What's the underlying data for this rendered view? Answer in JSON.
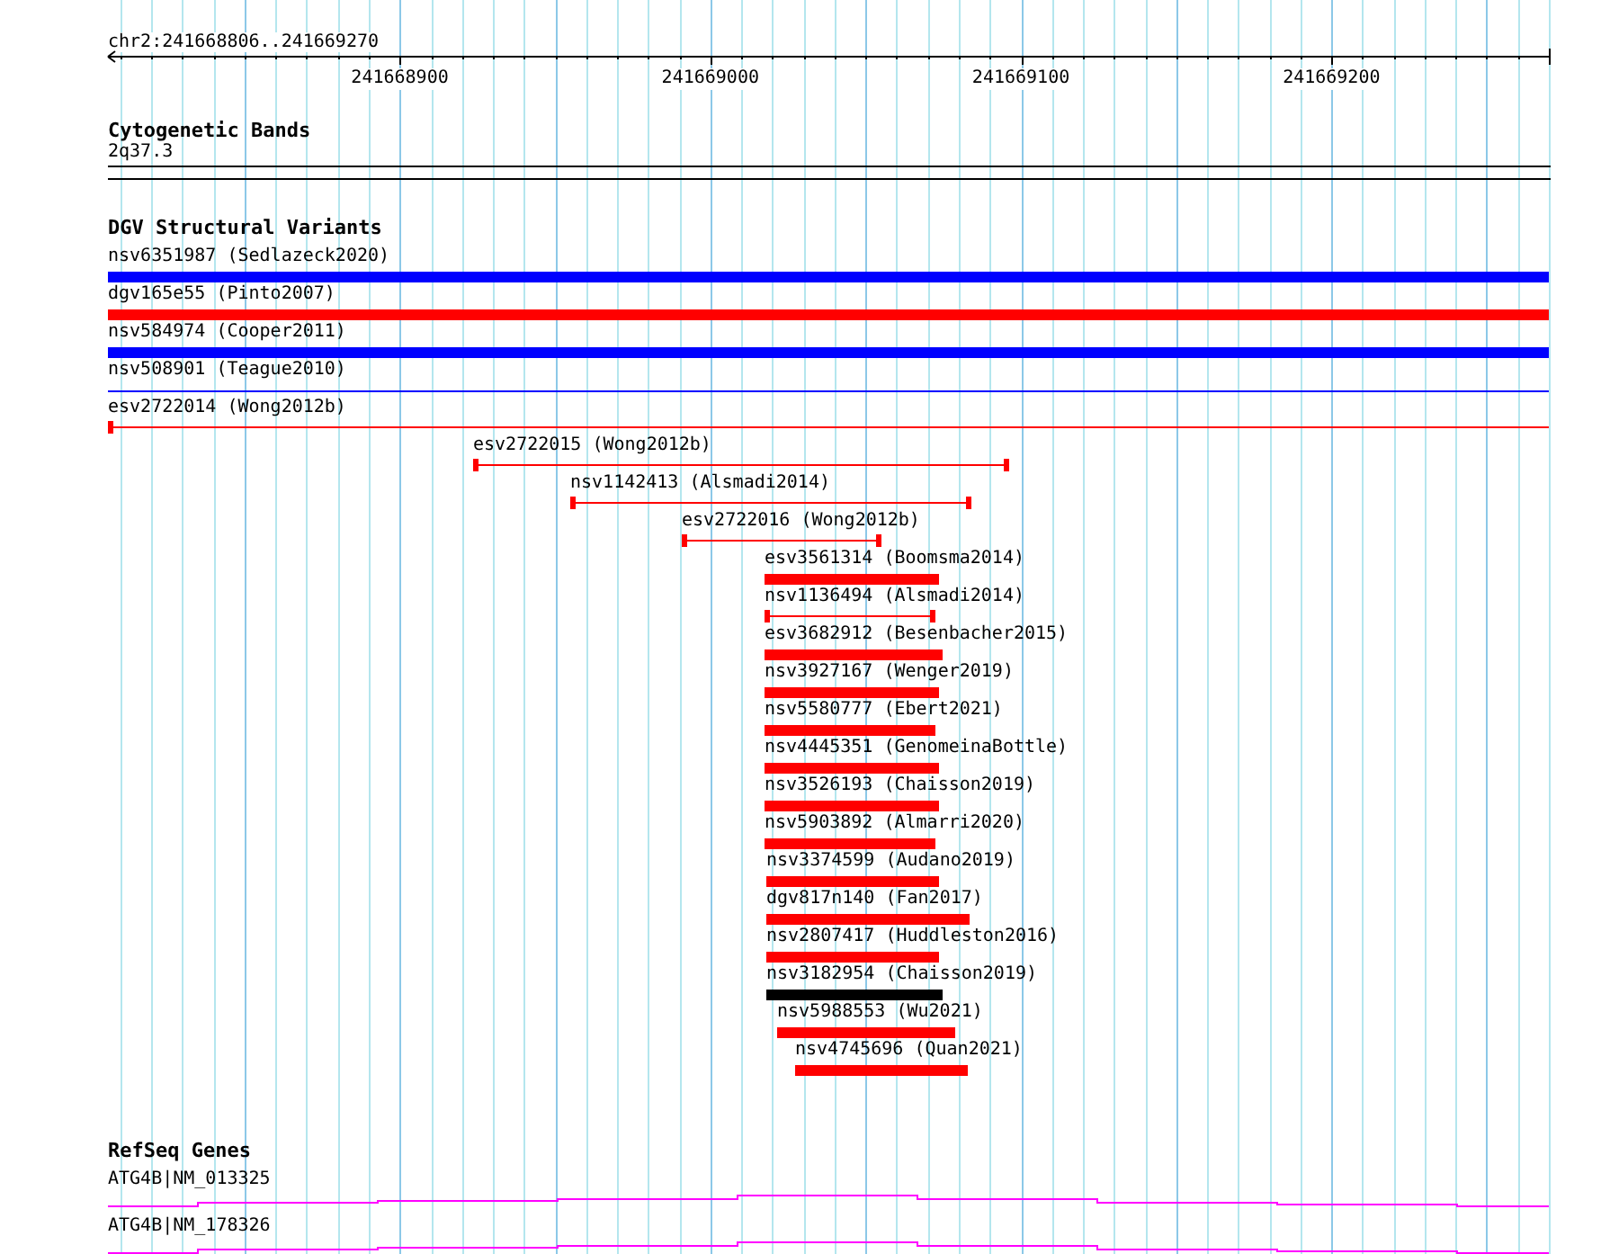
{
  "ruler": {
    "region": "chr2:241668806..241669270",
    "tick_labels": [
      "241668900",
      "241669000",
      "241669100",
      "241669200"
    ]
  },
  "cytogenetic_bands": {
    "title": "Cytogenetic Bands",
    "band": "2q37.3"
  },
  "dgv_structural_variants": {
    "title": "DGV Structural Variants",
    "features": [
      {
        "label": "nsv6351987 (Sedlazeck2020)",
        "kind": "thick",
        "color": "#0000ff"
      },
      {
        "label": "dgv165e55 (Pinto2007)",
        "kind": "thick",
        "color": "#ff0000"
      },
      {
        "label": "nsv584974 (Cooper2011)",
        "kind": "thick",
        "color": "#0000ff"
      },
      {
        "label": "nsv508901 (Teague2010)",
        "kind": "thin",
        "color": "#0000ff"
      },
      {
        "label": "esv2722014 (Wong2012b)",
        "kind": "capped",
        "color": "#ff0000"
      },
      {
        "label": "esv2722015 (Wong2012b)",
        "kind": "capped",
        "color": "#ff0000"
      },
      {
        "label": "nsv1142413 (Alsmadi2014)",
        "kind": "capped",
        "color": "#ff0000"
      },
      {
        "label": "esv2722016 (Wong2012b)",
        "kind": "capped",
        "color": "#ff0000"
      },
      {
        "label": "esv3561314 (Boomsma2014)",
        "kind": "thick",
        "color": "#ff0000"
      },
      {
        "label": "nsv1136494 (Alsmadi2014)",
        "kind": "capped",
        "color": "#ff0000"
      },
      {
        "label": "esv3682912 (Besenbacher2015)",
        "kind": "thick",
        "color": "#ff0000"
      },
      {
        "label": "nsv3927167 (Wenger2019)",
        "kind": "thick",
        "color": "#ff0000"
      },
      {
        "label": "nsv5580777 (Ebert2021)",
        "kind": "thick",
        "color": "#ff0000"
      },
      {
        "label": "nsv4445351 (GenomeinaBottle)",
        "kind": "thick",
        "color": "#ff0000"
      },
      {
        "label": "nsv3526193 (Chaisson2019)",
        "kind": "thick",
        "color": "#ff0000"
      },
      {
        "label": "nsv5903892 (Almarri2020)",
        "kind": "thick",
        "color": "#ff0000"
      },
      {
        "label": "nsv3374599 (Audano2019)",
        "kind": "thick",
        "color": "#ff0000"
      },
      {
        "label": "dgv817n140 (Fan2017)",
        "kind": "thick",
        "color": "#ff0000"
      },
      {
        "label": "nsv2807417 (Huddleston2016)",
        "kind": "thick",
        "color": "#ff0000"
      },
      {
        "label": "nsv3182954 (Chaisson2019)",
        "kind": "thick",
        "color": "#000000"
      },
      {
        "label": "nsv5988553 (Wu2021)",
        "kind": "thick",
        "color": "#ff0000"
      },
      {
        "label": "nsv4745696 (Quan2021)",
        "kind": "thick",
        "color": "#ff0000"
      }
    ]
  },
  "refseq_genes": {
    "title": "RefSeq Genes",
    "genes": [
      {
        "label": "ATG4B|NM_013325"
      },
      {
        "label": "ATG4B|NM_178326"
      }
    ]
  }
}
